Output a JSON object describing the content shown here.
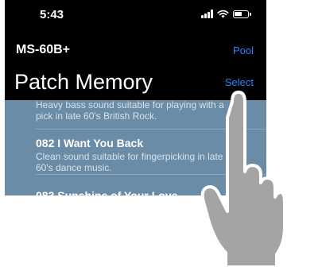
{
  "status_bar": {
    "time": "5:43"
  },
  "nav": {
    "device_name": "MS-60B+",
    "pool_label": "Pool"
  },
  "header": {
    "title": "Patch Memory",
    "select_label": "Select"
  },
  "patches": [
    {
      "name": "",
      "description": "Heavy bass sound suitable for playing with a pick in late 60's British Rock."
    },
    {
      "name": "082 I Want You Back",
      "description": "Clean sound suitable for fingerpicking in late 60's dance music."
    },
    {
      "name": "083 Sunshine of Your Love",
      "description": ""
    }
  ],
  "colors": {
    "accent": "#2f80ff",
    "list_bg": "#6b8ca6",
    "background": "#000000"
  }
}
